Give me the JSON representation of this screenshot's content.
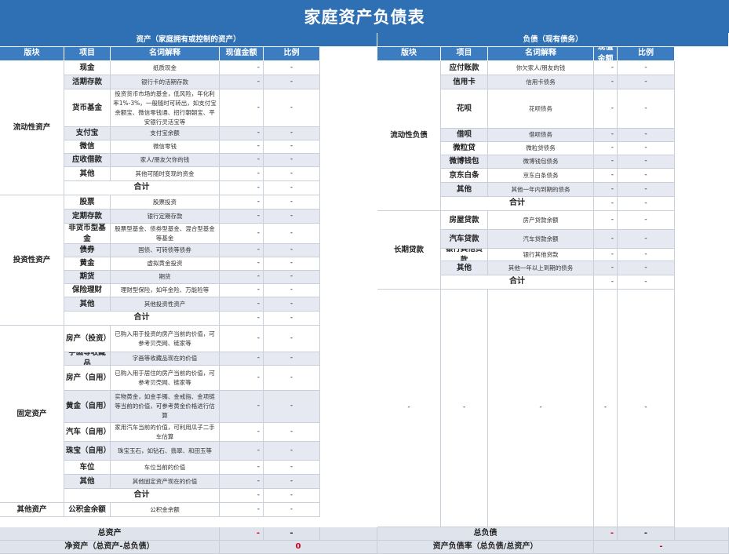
{
  "title": "家庭资产负债表",
  "assets": {
    "section_title": "资产（家庭拥有或控制的资产）",
    "headers": [
      "版块",
      "项目",
      "名词解释",
      "现值金额",
      "比例"
    ],
    "groups": [
      {
        "name": "流动性资产",
        "rows": [
          {
            "item": "现金",
            "desc": "纸质现金",
            "amount": "-",
            "ratio": "-"
          },
          {
            "item": "活期存款",
            "desc": "银行卡的活期存款",
            "amount": "-",
            "ratio": "-"
          },
          {
            "item": "货币基金",
            "desc": "投资货币市场的基金，低风险，年化利率1%-3%，一般随时可转出，如支付宝余额宝、微信零钱通、招行朝朝宝、平安银行灵活宝等",
            "amount": "-",
            "ratio": "-"
          },
          {
            "item": "支付宝",
            "desc": "支付宝余额",
            "amount": "-",
            "ratio": "-"
          },
          {
            "item": "微信",
            "desc": "微信零钱",
            "amount": "-",
            "ratio": "-"
          },
          {
            "item": "应收借款",
            "desc": "家人/朋友欠你的钱",
            "amount": "-",
            "ratio": "-"
          },
          {
            "item": "其他",
            "desc": "其他可随时变现的资金",
            "amount": "-",
            "ratio": "-"
          }
        ],
        "subtotal_label": "合计",
        "subtotal_amount": "-",
        "subtotal_ratio": "-"
      },
      {
        "name": "投资性资产",
        "rows": [
          {
            "item": "股票",
            "desc": "股票投资",
            "amount": "-",
            "ratio": "-"
          },
          {
            "item": "定期存款",
            "desc": "银行定期存款",
            "amount": "-",
            "ratio": "-"
          },
          {
            "item": "非货币型基金",
            "desc": "股票型基金、债券型基金、混合型基金等基金",
            "amount": "-",
            "ratio": "-"
          },
          {
            "item": "债券",
            "desc": "国债、可转债等债券",
            "amount": "-",
            "ratio": "-"
          },
          {
            "item": "黄金",
            "desc": "虚拟黄金投资",
            "amount": "-",
            "ratio": "-"
          },
          {
            "item": "期货",
            "desc": "期货",
            "amount": "-",
            "ratio": "-"
          },
          {
            "item": "保险理财",
            "desc": "理财型保险，如年金险、万能险等",
            "amount": "-",
            "ratio": "-"
          },
          {
            "item": "其他",
            "desc": "其他投资性资产",
            "amount": "-",
            "ratio": "-"
          }
        ],
        "subtotal_label": "合计",
        "subtotal_amount": "-",
        "subtotal_ratio": "-"
      },
      {
        "name": "固定资产",
        "rows": [
          {
            "item": "房产（投资）",
            "desc": "已购入用于投资的房产当前的价值，可参考贝壳网、链家等",
            "amount": "-",
            "ratio": "-"
          },
          {
            "item": "字画等收藏品",
            "desc": "字画等收藏品现在的价值",
            "amount": "-",
            "ratio": "-"
          },
          {
            "item": "房产（自用）",
            "desc": "已购入用于居住的房产当前的价值，可参考贝壳网、链家等",
            "amount": "-",
            "ratio": "-"
          },
          {
            "item": "黄金（自用）",
            "desc": "实物黄金，如金手镯、金戒指、金项链等当前的价值，可参考黄金价格进行估算",
            "amount": "-",
            "ratio": "-"
          },
          {
            "item": "汽车（自用）",
            "desc": "家用汽车当前的价值，可利用瓜子二手车估算",
            "amount": "-",
            "ratio": "-"
          },
          {
            "item": "珠宝（自用）",
            "desc": "珠宝玉石，如钻石、翡翠、和田玉等",
            "amount": "-",
            "ratio": "-"
          },
          {
            "item": "车位",
            "desc": "车位当前的价值",
            "amount": "-",
            "ratio": "-"
          },
          {
            "item": "其他",
            "desc": "其他固定资产现在的价值",
            "amount": "-",
            "ratio": "-"
          }
        ],
        "subtotal_label": "合计",
        "subtotal_amount": "-",
        "subtotal_ratio": "-"
      },
      {
        "name": "其他资产",
        "rows": [
          {
            "item": "公积金余额",
            "desc": "公积金余额",
            "amount": "-",
            "ratio": "-"
          }
        ]
      }
    ],
    "total_label": "总资产",
    "total_amount": "-",
    "total_ratio": "-",
    "net_label": "净资产（总资产-总负债）",
    "net_value": "0"
  },
  "liabilities": {
    "section_title": "负债（现有债务）",
    "headers": [
      "版块",
      "项目",
      "名词解释",
      "现值金额",
      "比例"
    ],
    "groups": [
      {
        "name": "流动性负债",
        "rows": [
          {
            "item": "应付账款",
            "desc": "你欠家人/朋友的钱",
            "amount": "-",
            "ratio": "-"
          },
          {
            "item": "信用卡",
            "desc": "信用卡债务",
            "amount": "-",
            "ratio": "-"
          },
          {
            "item": "花呗",
            "desc": "花呗债务",
            "amount": "-",
            "ratio": "-"
          },
          {
            "item": "借呗",
            "desc": "借呗债务",
            "amount": "-",
            "ratio": "-"
          },
          {
            "item": "微粒贷",
            "desc": "微粒贷债务",
            "amount": "-",
            "ratio": "-"
          },
          {
            "item": "微博钱包",
            "desc": "微博钱包债务",
            "amount": "-",
            "ratio": "-"
          },
          {
            "item": "京东白条",
            "desc": "京东白条债务",
            "amount": "-",
            "ratio": "-"
          },
          {
            "item": "其他",
            "desc": "其他一年内到期的债务",
            "amount": "-",
            "ratio": "-"
          }
        ],
        "subtotal_label": "合计",
        "subtotal_amount": "-",
        "subtotal_ratio": "-"
      },
      {
        "name": "长期贷款",
        "rows": [
          {
            "item": "房屋贷款",
            "desc": "房产贷款余额",
            "amount": "-",
            "ratio": "-"
          },
          {
            "item": "汽车贷款",
            "desc": "汽车贷款余额",
            "amount": "-",
            "ratio": "-"
          },
          {
            "item": "银行其他贷款",
            "desc": "银行其他贷款",
            "amount": "-",
            "ratio": "-"
          },
          {
            "item": "其他",
            "desc": "其他一年以上到期的债务",
            "amount": "-",
            "ratio": "-"
          }
        ],
        "subtotal_label": "合计",
        "subtotal_amount": "-",
        "subtotal_ratio": "-"
      }
    ],
    "empty_block": [
      "-",
      "-",
      "-",
      "-",
      "-"
    ],
    "total_label": "总负债",
    "total_amount": "-",
    "total_ratio": "-",
    "ratio_label": "资产负债率（总负债/总资产）",
    "ratio_value": "-"
  }
}
